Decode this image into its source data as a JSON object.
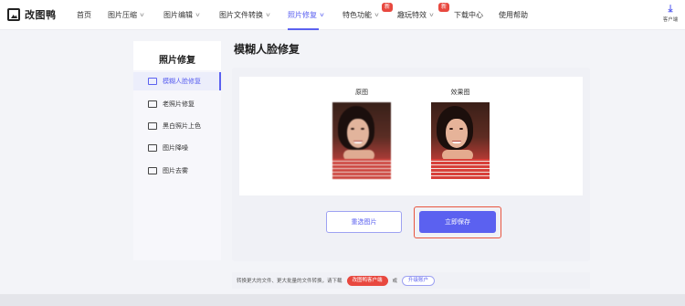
{
  "app": {
    "logo_text": "改图鸭"
  },
  "nav": {
    "items": [
      {
        "label": "首页",
        "dropdown": false
      },
      {
        "label": "图片压缩",
        "dropdown": true
      },
      {
        "label": "图片编辑",
        "dropdown": true
      },
      {
        "label": "图片文件转换",
        "dropdown": true
      },
      {
        "label": "照片修复",
        "dropdown": true,
        "active": true
      },
      {
        "label": "特色功能",
        "dropdown": true,
        "badge": "新"
      },
      {
        "label": "趣玩特效",
        "dropdown": true,
        "badge": "新"
      },
      {
        "label": "下载中心",
        "dropdown": false
      },
      {
        "label": "使用帮助",
        "dropdown": false
      }
    ],
    "client_label": "客户端",
    "accent_color": "#5b61f0",
    "badge_color": "#e8483f"
  },
  "sidebar": {
    "title": "照片修复",
    "items": [
      {
        "label": "模糊人脸修复",
        "icon": "face-repair-icon",
        "active": true
      },
      {
        "label": "老照片修复",
        "icon": "old-photo-icon"
      },
      {
        "label": "黑白照片上色",
        "icon": "colorize-icon"
      },
      {
        "label": "图片降噪",
        "icon": "denoise-icon"
      },
      {
        "label": "图片去雾",
        "icon": "dehaze-icon"
      }
    ]
  },
  "main": {
    "title": "模糊人脸修复",
    "original_label": "原图",
    "result_label": "效果图",
    "reselect_label": "重选图片",
    "save_label": "立即保存"
  },
  "bottom": {
    "text": "转换更大的文件、更大批量的文件转换，请下载",
    "client_button": "改图鸭客户端",
    "or_text": "或",
    "upgrade_button": "升级账户"
  }
}
